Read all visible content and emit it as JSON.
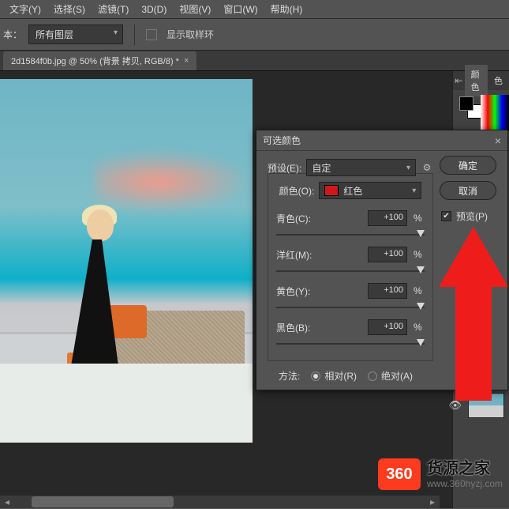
{
  "menubar": {
    "items": [
      "文字(Y)",
      "选择(S)",
      "滤镜(T)",
      "3D(D)",
      "视图(V)",
      "窗口(W)",
      "帮助(H)"
    ]
  },
  "optbar": {
    "label": "本：",
    "dropdown": "所有图层",
    "show_sample": "显示取样环"
  },
  "tab": {
    "label": "2d1584f0b.jpg @ 50% (背景 拷贝, RGB/8) *"
  },
  "panel": {
    "tab_color": "颜色",
    "tab_swatch": "色"
  },
  "dialog": {
    "title": "可选颜色",
    "preset_label": "预设(E):",
    "preset_value": "自定",
    "color_label": "颜色(O):",
    "color_value": "红色",
    "sliders": [
      {
        "label": "青色(C):",
        "value": "+100"
      },
      {
        "label": "洋红(M):",
        "value": "+100"
      },
      {
        "label": "黄色(Y):",
        "value": "+100"
      },
      {
        "label": "黑色(B):",
        "value": "+100"
      }
    ],
    "pct": "%",
    "method_label": "方法:",
    "method_relative": "相对(R)",
    "method_absolute": "绝对(A)",
    "ok": "确定",
    "cancel": "取消",
    "preview": "预览(P)"
  },
  "watermark": {
    "badge": "360",
    "title": "货源之家",
    "url": "www.360hyzj.com"
  }
}
